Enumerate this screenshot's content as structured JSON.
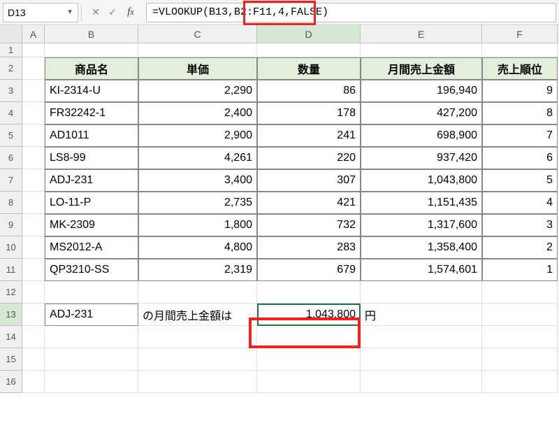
{
  "name_box": "D13",
  "formula": "=VLOOKUP(B13,B2:F11,4,FALSE)",
  "formula_parts": {
    "p1": "=VLOOKUP(B13,",
    "p2": "B2:F11,4,",
    "p3": "FALSE)"
  },
  "columns": [
    "A",
    "B",
    "C",
    "D",
    "E",
    "F"
  ],
  "active_column": "D",
  "active_row": "13",
  "headers": {
    "b": "商品名",
    "c": "単価",
    "d": "数量",
    "e": "月間売上金額",
    "f": "売上順位"
  },
  "table_rows": [
    {
      "b": "KI-2314-U",
      "c": "2,290",
      "d": "86",
      "e": "196,940",
      "f": "9"
    },
    {
      "b": "FR32242-1",
      "c": "2,400",
      "d": "178",
      "e": "427,200",
      "f": "8"
    },
    {
      "b": "AD1011",
      "c": "2,900",
      "d": "241",
      "e": "698,900",
      "f": "7"
    },
    {
      "b": "LS8-99",
      "c": "4,261",
      "d": "220",
      "e": "937,420",
      "f": "6"
    },
    {
      "b": "ADJ-231",
      "c": "3,400",
      "d": "307",
      "e": "1,043,800",
      "f": "5"
    },
    {
      "b": "LO-11-P",
      "c": "2,735",
      "d": "421",
      "e": "1,151,435",
      "f": "4"
    },
    {
      "b": "MK-2309",
      "c": "1,800",
      "d": "732",
      "e": "1,317,600",
      "f": "3"
    },
    {
      "b": "MS2012-A",
      "c": "4,800",
      "d": "283",
      "e": "1,358,400",
      "f": "2"
    },
    {
      "b": "QP3210-SS",
      "c": "2,319",
      "d": "679",
      "e": "1,574,601",
      "f": "1"
    }
  ],
  "result_row": {
    "b": "ADJ-231",
    "c": "の月間売上金額は",
    "d": "1,043,800",
    "e": "円"
  },
  "row_numbers": [
    "1",
    "2",
    "3",
    "4",
    "5",
    "6",
    "7",
    "8",
    "9",
    "10",
    "11",
    "12",
    "13",
    "14",
    "15",
    "16"
  ]
}
